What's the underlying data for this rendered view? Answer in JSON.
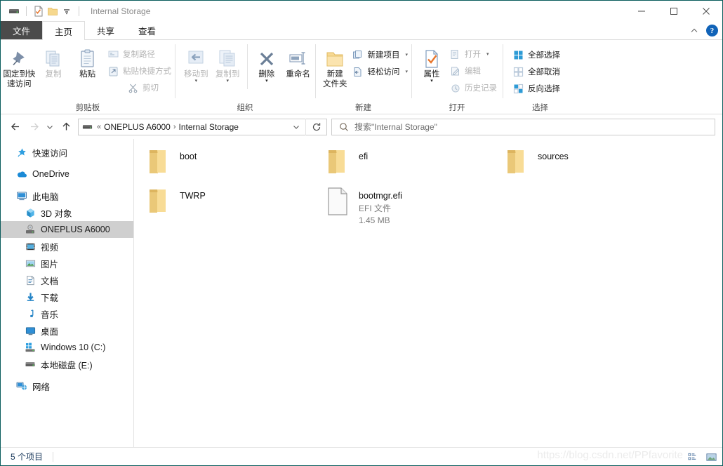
{
  "window": {
    "title": "Internal Storage",
    "quick_access": [
      {
        "name": "drive-icon",
        "label": "Internal Storage drive"
      },
      {
        "name": "properties-icon",
        "label": "属性"
      },
      {
        "name": "new-folder-icon",
        "label": "新建文件夹"
      },
      {
        "name": "customize-qat-icon",
        "label": "自定义快速访问工具栏"
      }
    ],
    "controls": {
      "minimize": "最小化",
      "maximize": "最大化",
      "close": "关闭"
    }
  },
  "tabs": [
    {
      "id": "file",
      "label": "文件"
    },
    {
      "id": "home",
      "label": "主页"
    },
    {
      "id": "share",
      "label": "共享"
    },
    {
      "id": "view",
      "label": "查看"
    }
  ],
  "ribbon": {
    "collapse_label": "折叠功能区",
    "help_label": "?",
    "groups": [
      {
        "label": "剪贴板",
        "big_buttons": [
          {
            "label": "固定到快\n速访问",
            "label_line1": "固定到快",
            "label_line2": "速访问",
            "icon": "pin-icon",
            "disabled": false
          },
          {
            "label": "复制",
            "icon": "copy-icon",
            "disabled": true
          },
          {
            "label": "粘贴",
            "icon": "paste-icon",
            "disabled": false
          }
        ],
        "small_buttons": [
          {
            "label": "复制路径",
            "icon": "copy-path-icon",
            "disabled": true
          },
          {
            "label": "粘贴快捷方式",
            "icon": "paste-shortcut-icon",
            "disabled": true
          },
          {
            "label": "剪切",
            "icon": "cut-icon",
            "disabled": true
          }
        ]
      },
      {
        "label": "组织",
        "big_buttons": [
          {
            "label": "移动到",
            "icon": "move-to-icon",
            "disabled": true,
            "has_caret": true
          },
          {
            "label": "复制到",
            "icon": "copy-to-icon",
            "disabled": true,
            "has_caret": true
          },
          {
            "label": "删除",
            "icon": "delete-icon",
            "disabled": false,
            "has_caret": true
          },
          {
            "label": "重命名",
            "icon": "rename-icon",
            "disabled": false
          }
        ]
      },
      {
        "label": "新建",
        "big_buttons": [
          {
            "label_line1": "新建",
            "label_line2": "文件夹",
            "icon": "new-folder-icon",
            "disabled": false
          }
        ],
        "small_buttons": [
          {
            "label": "新建项目",
            "icon": "new-item-icon",
            "disabled": false,
            "has_caret": true
          },
          {
            "label": "轻松访问",
            "icon": "easy-access-icon",
            "disabled": false,
            "has_caret": true
          }
        ]
      },
      {
        "label": "打开",
        "big_buttons": [
          {
            "label": "属性",
            "icon": "properties-icon",
            "disabled": false,
            "has_caret": true
          }
        ],
        "small_buttons": [
          {
            "label": "打开",
            "icon": "open-icon",
            "disabled": true,
            "has_caret": true
          },
          {
            "label": "编辑",
            "icon": "edit-icon",
            "disabled": true
          },
          {
            "label": "历史记录",
            "icon": "history-icon",
            "disabled": true
          }
        ]
      },
      {
        "label": "选择",
        "small_buttons": [
          {
            "label": "全部选择",
            "icon": "select-all-icon",
            "disabled": false
          },
          {
            "label": "全部取消",
            "icon": "select-none-icon",
            "disabled": false
          },
          {
            "label": "反向选择",
            "icon": "invert-selection-icon",
            "disabled": false
          }
        ]
      }
    ]
  },
  "addressbar": {
    "back_label": "后退",
    "forward_label": "前进",
    "recent_label": "最近浏览的位置",
    "up_label": "上移到",
    "device_icon": "drive-icon",
    "overflow": "«",
    "breadcrumbs": [
      "ONEPLUS A6000",
      "Internal Storage"
    ],
    "separator": "›",
    "dropdown_label": "上一个位置",
    "refresh_label": "刷新",
    "search": {
      "icon": "search-icon",
      "placeholder": "搜索\"Internal Storage\"",
      "value": ""
    }
  },
  "sidebar": {
    "items": [
      {
        "label": "快速访问",
        "icon": "star-pin-icon",
        "level": 1,
        "selected": false,
        "gap_after": true
      },
      {
        "label": "OneDrive",
        "icon": "onedrive-cloud-icon",
        "level": 1,
        "selected": false,
        "gap_after": true
      },
      {
        "label": "此电脑",
        "icon": "this-pc-icon",
        "level": 1,
        "selected": false
      },
      {
        "label": "3D 对象",
        "icon": "3d-objects-icon",
        "level": 2,
        "selected": false
      },
      {
        "label": "ONEPLUS A6000",
        "icon": "phone-device-icon",
        "level": 2,
        "selected": true
      },
      {
        "label": "视频",
        "icon": "videos-icon",
        "level": 2,
        "selected": false
      },
      {
        "label": "图片",
        "icon": "pictures-icon",
        "level": 2,
        "selected": false
      },
      {
        "label": "文档",
        "icon": "documents-icon",
        "level": 2,
        "selected": false
      },
      {
        "label": "下载",
        "icon": "downloads-icon",
        "level": 2,
        "selected": false
      },
      {
        "label": "音乐",
        "icon": "music-icon",
        "level": 2,
        "selected": false
      },
      {
        "label": "桌面",
        "icon": "desktop-icon",
        "level": 2,
        "selected": false
      },
      {
        "label": "Windows 10 (C:)",
        "icon": "windows-drive-icon",
        "level": 2,
        "selected": false
      },
      {
        "label": "本地磁盘 (E:)",
        "icon": "local-drive-icon",
        "level": 2,
        "selected": false,
        "gap_after": true
      },
      {
        "label": "网络",
        "icon": "network-icon",
        "level": 1,
        "selected": false
      }
    ]
  },
  "files": {
    "items": [
      {
        "name": "boot",
        "type": "folder",
        "icon": "folder-icon",
        "meta1": "",
        "meta2": ""
      },
      {
        "name": "efi",
        "type": "folder",
        "icon": "folder-icon",
        "meta1": "",
        "meta2": ""
      },
      {
        "name": "sources",
        "type": "folder",
        "icon": "folder-icon",
        "meta1": "",
        "meta2": ""
      },
      {
        "name": "TWRP",
        "type": "folder",
        "icon": "folder-icon",
        "meta1": "",
        "meta2": ""
      },
      {
        "name": "bootmgr.efi",
        "type": "file",
        "icon": "generic-file-icon",
        "meta1": "EFI 文件",
        "meta2": "1.45 MB"
      }
    ]
  },
  "statusbar": {
    "count_text": "5 个项目",
    "watermark": "https://blog.csdn.net/PPfavorite",
    "view_buttons": [
      {
        "name": "details-view-button",
        "label": "详细信息"
      },
      {
        "name": "large-icons-view-button",
        "label": "大图标"
      }
    ]
  },
  "colors": {
    "window_border": "#0a5c5c",
    "file_tab_bg": "#4b4b4b",
    "folder_yellow": "#f5d58a",
    "selection_gray": "#cfcfcf",
    "help_blue": "#1163b8",
    "status_text": "#1b3a5c"
  }
}
